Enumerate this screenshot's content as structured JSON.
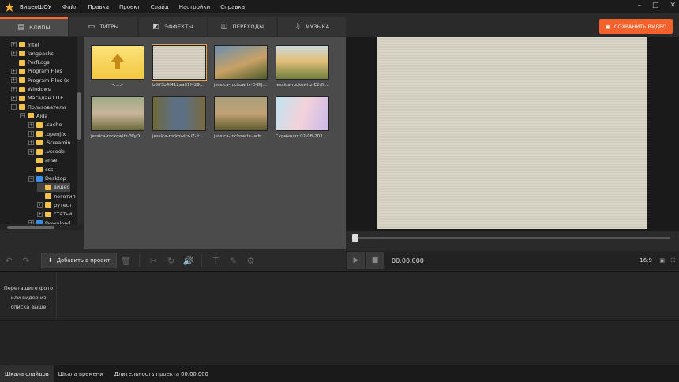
{
  "app": {
    "name": "ВидеоШОУ"
  },
  "menu": [
    "Файл",
    "Правка",
    "Проект",
    "Слайд",
    "Настройки",
    "Справка"
  ],
  "tabs": [
    {
      "label": "КЛИПЫ",
      "icon": "folder-icon",
      "active": true
    },
    {
      "label": "ТИТРЫ",
      "icon": "titles-icon"
    },
    {
      "label": "ЭФФЕКТЫ",
      "icon": "effects-icon"
    },
    {
      "label": "ПЕРЕХОДЫ",
      "icon": "transitions-icon"
    },
    {
      "label": "МУЗЫКА",
      "icon": "music-icon"
    }
  ],
  "save_button": "СОХРАНИТЬ ВИДЕО",
  "tree": [
    {
      "label": "Intel",
      "indent": 1,
      "exp": "+"
    },
    {
      "label": "langpacks",
      "indent": 1,
      "exp": "+"
    },
    {
      "label": "PerfLogs",
      "indent": 1,
      "exp": ""
    },
    {
      "label": "Program Files",
      "indent": 1,
      "exp": "+"
    },
    {
      "label": "Program Files (x",
      "indent": 1,
      "exp": "+"
    },
    {
      "label": "Windows",
      "indent": 1,
      "exp": "+"
    },
    {
      "label": "Магадан LITE",
      "indent": 1,
      "exp": "+"
    },
    {
      "label": "Пользователи",
      "indent": 1,
      "exp": "−"
    },
    {
      "label": "Aida",
      "indent": 2,
      "exp": "−"
    },
    {
      "label": ".cache",
      "indent": 3,
      "exp": "+"
    },
    {
      "label": ".openjfx",
      "indent": 3,
      "exp": "+"
    },
    {
      "label": ".Screamin",
      "indent": 3,
      "exp": "+"
    },
    {
      "label": ".vscode",
      "indent": 3,
      "exp": "+"
    },
    {
      "label": "ansel",
      "indent": 3,
      "exp": ""
    },
    {
      "label": "css",
      "indent": 3,
      "exp": ""
    },
    {
      "label": "Desktop",
      "indent": 3,
      "exp": "−",
      "blue": true
    },
    {
      "label": "видео",
      "indent": 4,
      "exp": "",
      "selected": true
    },
    {
      "label": "логотип",
      "indent": 4,
      "exp": ""
    },
    {
      "label": "рутест",
      "indent": 4,
      "exp": "+"
    },
    {
      "label": "статьи",
      "indent": 4,
      "exp": "+"
    },
    {
      "label": "Download",
      "indent": 3,
      "exp": "+",
      "blue": true
    }
  ],
  "thumbs": [
    {
      "caption": "<...>",
      "kind": "up"
    },
    {
      "caption": "b6ff3b4f412aa01f429d3d...",
      "kind": "texture",
      "selected": true
    },
    {
      "caption": "jessica-rockowitz-D-8lJryA...",
      "kind": "photo1"
    },
    {
      "caption": "jessica-rockowitz-E2d943e...",
      "kind": "photo2"
    },
    {
      "caption": "jessica-rockowitz-3FyDZBS...",
      "kind": "photo3"
    },
    {
      "caption": "jessica-rockowitz-iZ-ItdBV3j...",
      "kind": "photo4"
    },
    {
      "caption": "jessica-rockowitz-uefr5_gt...",
      "kind": "photo5"
    },
    {
      "caption": "Скриншот 02-08-2023 17...",
      "kind": "screen"
    }
  ],
  "toolbar": {
    "add_label": "Добавить в проект"
  },
  "player": {
    "time": "00:00.000",
    "ratio": "16:9"
  },
  "timeline": {
    "hint": "Перетащите фото или видео из списка выше"
  },
  "status": {
    "tab1": "Шкала слайдов",
    "tab2": "Шкала времени",
    "duration": "Длительность проекта 00:00.000"
  }
}
